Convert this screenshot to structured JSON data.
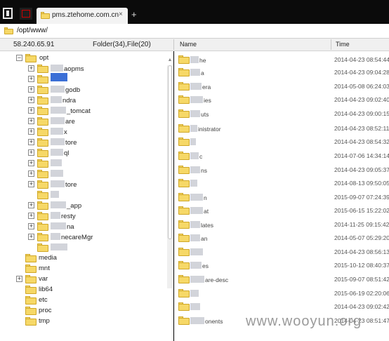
{
  "tab": {
    "title": "pms.ztehome.com.cn",
    "close": "×",
    "new_tab": "+"
  },
  "address": {
    "path": "/opt/www/"
  },
  "info": {
    "ip": "58.240.65.91",
    "counts": "Folder(34),File(20)",
    "col_name": "Name",
    "col_time": "Time"
  },
  "tree": {
    "items": [
      {
        "label": "opt",
        "exp": "−"
      },
      {
        "label": "aopms",
        "exp": "+"
      },
      {
        "label": "",
        "exp": "+"
      },
      {
        "label": "godb",
        "exp": "+"
      },
      {
        "label": "ndra",
        "exp": "+"
      },
      {
        "label": "_tomcat",
        "exp": "+"
      },
      {
        "label": "are",
        "exp": "+"
      },
      {
        "label": "x",
        "exp": "+"
      },
      {
        "label": "tore",
        "exp": "+"
      },
      {
        "label": "ql",
        "exp": "+"
      },
      {
        "label": "",
        "exp": "+"
      },
      {
        "label": "",
        "exp": "+"
      },
      {
        "label": "tore",
        "exp": "+"
      },
      {
        "label": "",
        "exp": ""
      },
      {
        "label": "_app",
        "exp": "+"
      },
      {
        "label": "resty",
        "exp": "+"
      },
      {
        "label": "na",
        "exp": "+"
      },
      {
        "label": "necareMgr",
        "exp": "+"
      },
      {
        "label": "",
        "exp": ""
      },
      {
        "label": "media",
        "exp": ""
      },
      {
        "label": "mnt",
        "exp": ""
      },
      {
        "label": "var",
        "exp": "+"
      },
      {
        "label": "lib64",
        "exp": ""
      },
      {
        "label": "etc",
        "exp": ""
      },
      {
        "label": "proc",
        "exp": ""
      },
      {
        "label": "tmp",
        "exp": ""
      }
    ]
  },
  "list": {
    "rows": [
      {
        "name": "he",
        "time": "2014-04-23 08:54:44"
      },
      {
        "name": "a",
        "time": "2014-04-23 09:04:28"
      },
      {
        "name": "era",
        "time": "2014-05-08 06:24:03"
      },
      {
        "name": "ies",
        "time": "2014-04-23 09:02:40"
      },
      {
        "name": "uts",
        "time": "2014-04-23 09:00:15"
      },
      {
        "name": "inistrator",
        "time": "2014-04-23 08:52:11"
      },
      {
        "name": "",
        "time": "2014-04-23 08:54:32"
      },
      {
        "name": "c",
        "time": "2014-07-06 14:34:14"
      },
      {
        "name": "ns",
        "time": "2014-04-23 09:05:37"
      },
      {
        "name": "",
        "time": "2014-08-13 09:50:05"
      },
      {
        "name": "n",
        "time": "2015-09-07 07:24:39"
      },
      {
        "name": "at",
        "time": "2015-06-15 15:22:02"
      },
      {
        "name": "lates",
        "time": "2014-11-25 09:15:42"
      },
      {
        "name": "an",
        "time": "2014-05-07 05:29:20"
      },
      {
        "name": "",
        "time": "2014-04-23 08:56:13"
      },
      {
        "name": "es",
        "time": "2015-10-12 08:40:37"
      },
      {
        "name": "are-desc",
        "time": "2015-09-07 08:51:42"
      },
      {
        "name": "",
        "time": "2015-06-19 02:20:06"
      },
      {
        "name": "",
        "time": "2014-04-23 09:02:42"
      },
      {
        "name": "onents",
        "time": "2014-04-23 08:51:47"
      }
    ]
  },
  "watermark": "www.wooyun.org",
  "scroll": {
    "up": "▲",
    "down": "▼"
  }
}
